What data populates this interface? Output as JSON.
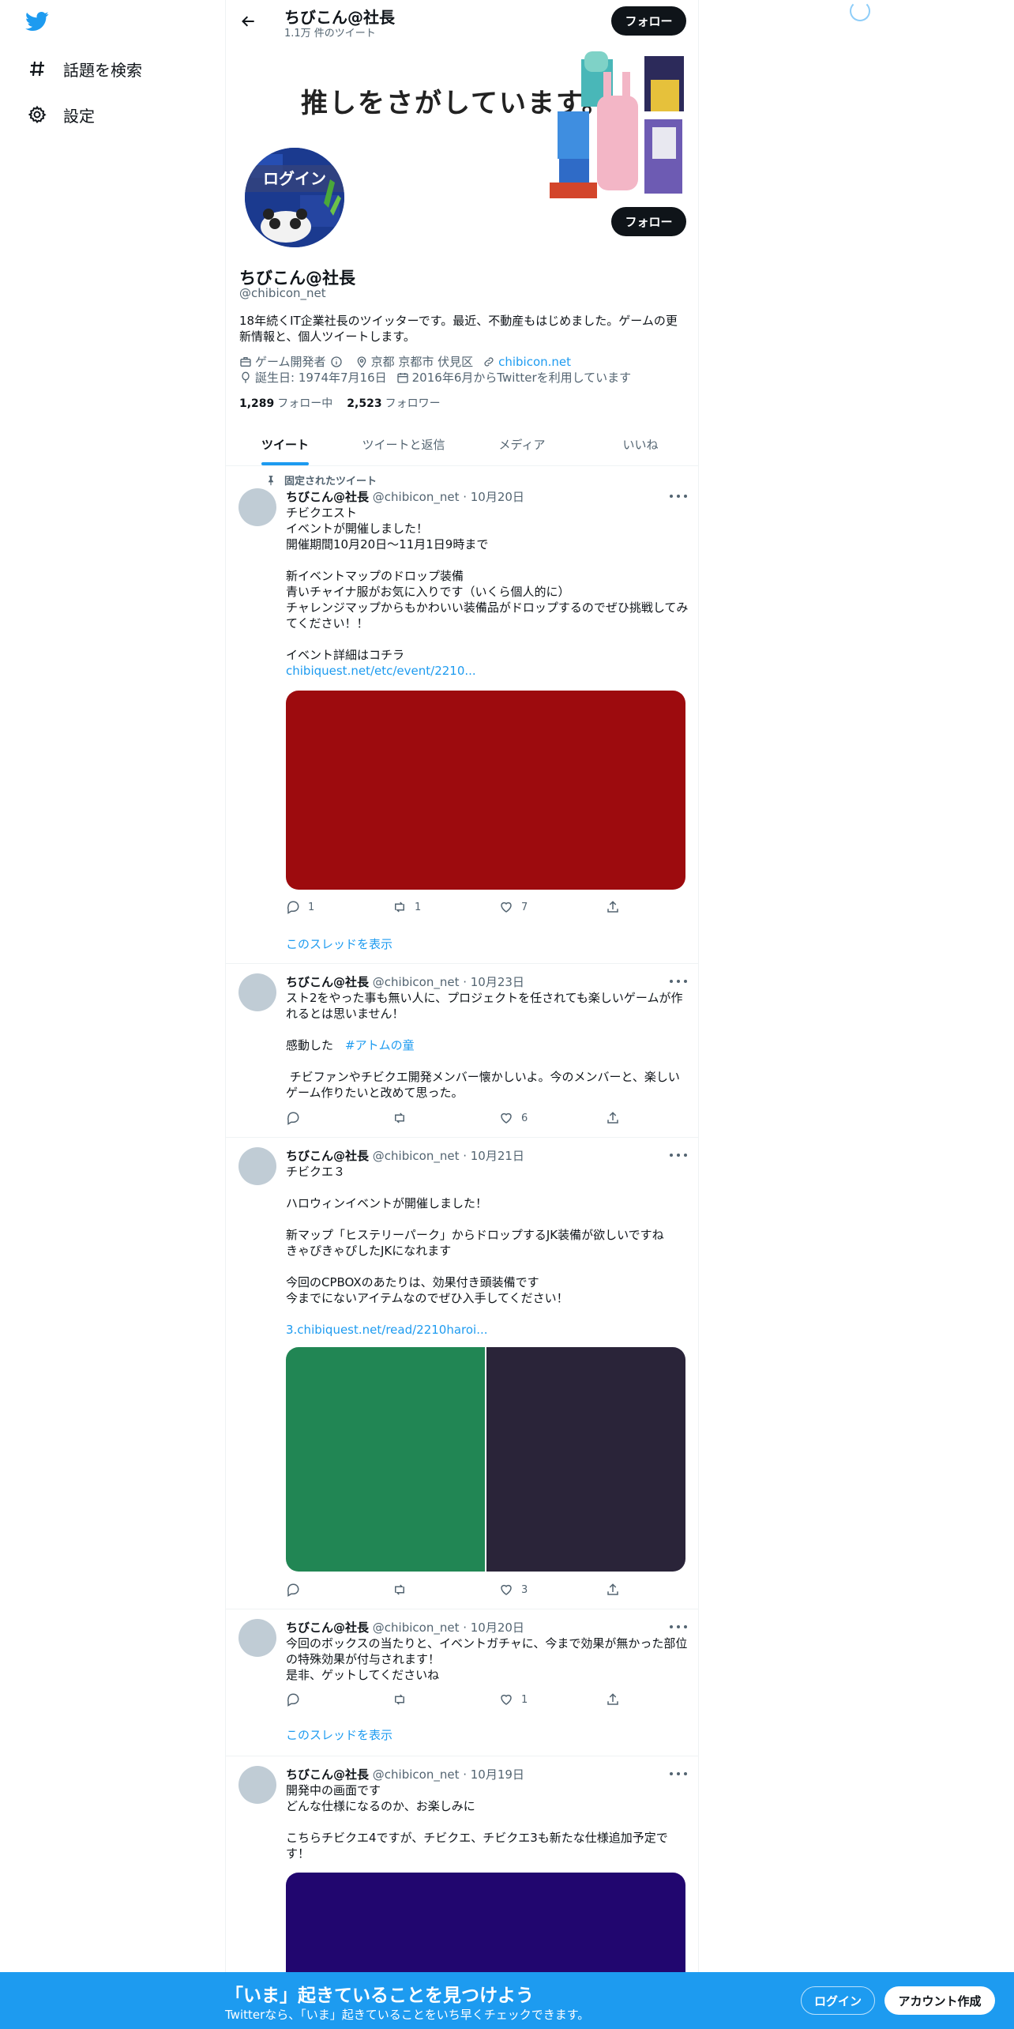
{
  "nav": {
    "explore_label": "話題を検索",
    "settings_label": "設定"
  },
  "topbar": {
    "name": "ちびこん@社長",
    "tweet_count": "1.1万 件のツイート",
    "follow_label": "フォロー"
  },
  "banner": {
    "text": "推しをさがしています。"
  },
  "avatar": {
    "text": "ログイン"
  },
  "profile": {
    "follow_label": "フォロー",
    "name": "ちびこん@社長",
    "handle": "@chibicon_net",
    "bio": "18年続くIT企業社長のツイッターです。最近、不動産もはじめました。ゲームの更新情報と、個人ツイートします。",
    "category": "ゲーム開発者",
    "location": "京都 京都市 伏見区",
    "website": "chibicon.net",
    "birthday": "誕生日: 1974年7月16日",
    "joined": "2016年6月からTwitterを利用しています",
    "following_count": "1,289",
    "following_label": "フォロー中",
    "followers_count": "2,523",
    "followers_label": "フォロワー"
  },
  "tabs": [
    "ツイート",
    "ツイートと返信",
    "メディア",
    "いいね"
  ],
  "tweets": [
    {
      "pinned_label": "固定されたツイート",
      "name": "ちびこん@社長",
      "meta": "@chibicon_net · 10月20日",
      "body": "チビクエスト\nイベントが開催しました！\n開催期間10月20日～11月1日9時まで\n\n新イベントマップのドロップ装備\n青いチャイナ服がお気に入りです（いくら個人的に）\nチャレンジマップからもかわいい装備品がドロップするのでぜひ挑戦してみてください！！\n\nイベント詳細はコチラ",
      "link": "chibiquest.net/etc/event/2210...",
      "media_colors": [
        "#9d0b0e"
      ],
      "reply_count": "1",
      "retweet_count": "1",
      "like_count": "7",
      "thread_label": "このスレッドを表示"
    },
    {
      "name": "ちびこん@社長",
      "meta": "@chibicon_net · 10月23日",
      "body_1": "スト2をやった事も無い人に、プロジェクトを任されても楽しいゲームが作れるとは思いません！\n\n感動した",
      "hashtag": "#アトムの童",
      "body_2": " チビファンやチビクエ開発メンバー懐かしいよ。今のメンバーと、楽しいゲーム作りたいと改めて思った。",
      "reply_count": "",
      "retweet_count": "",
      "like_count": "6"
    },
    {
      "name": "ちびこん@社長",
      "meta": "@chibicon_net · 10月21日",
      "body": "チビクエ３\n\nハロウィンイベントが開催しました！\n\n新マップ「ヒステリーパーク」からドロップするJK装備が欲しいですね\nきゃぴきゃぴしたJKになれます\n\n今回のCPBOXのあたりは、効果付き頭装備です\n今までにないアイテムなのでぜひ入手してください！",
      "link": "3.chibiquest.net/read/2210haroi...",
      "media_colors": [
        "#218654",
        "#2a2439"
      ],
      "reply_count": "",
      "retweet_count": "",
      "like_count": "3"
    },
    {
      "name": "ちびこん@社長",
      "meta": "@chibicon_net · 10月20日",
      "body": "今回のボックスの当たりと、イベントガチャに、今まで効果が無かった部位の特殊効果が付与されます！\n是非、ゲットしてくださいね",
      "reply_count": "",
      "retweet_count": "",
      "like_count": "1",
      "thread_label": "このスレッドを表示"
    },
    {
      "name": "ちびこん@社長",
      "meta": "@chibicon_net · 10月19日",
      "body": "開発中の画面です\nどんな仕様になるのか、お楽しみに\n\nこちらチビクエ4ですが、チビクエ、チビクエ3も新たな仕様追加予定です！",
      "media_colors": [
        "#21066f"
      ]
    }
  ],
  "bottom": {
    "title": "「いま」起きていることを見つけよう",
    "subtitle": "Twitterなら、「いま」起きていることをいち早くチェックできます。",
    "login_label": "ログイン",
    "signup_label": "アカウント作成"
  },
  "colors": {
    "accent": "#1d9bf0",
    "text": "#0f1419",
    "muted": "#536471"
  }
}
